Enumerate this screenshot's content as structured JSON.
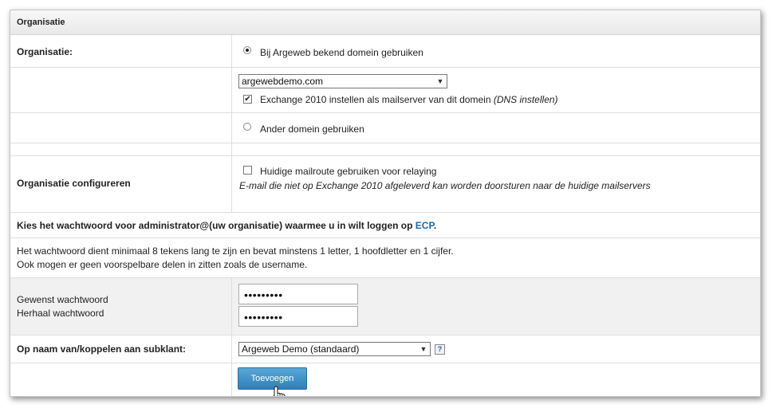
{
  "section_title": "Organisatie",
  "organisatie": {
    "label": "Organisatie:",
    "option_known": "Bij Argeweb bekend domein gebruiken",
    "domain_select": "argewebdemo.com",
    "exchange_check_label": "Exchange 2010 instellen als mailserver van dit domein",
    "exchange_check_note": "(DNS instellen)",
    "option_other": "Ander domein gebruiken"
  },
  "configureren": {
    "label": "Organisatie configureren",
    "relay_label": "Huidige mailroute gebruiken voor relaying",
    "relay_note": "E-mail die niet op Exchange 2010 afgeleverd kan worden doorsturen naar de huidige mailservers"
  },
  "password": {
    "heading_prefix": "Kies het wachtwoord voor administrator@(uw organisatie) waarmee u in wilt loggen op",
    "heading_link": "ECP",
    "heading_suffix": ".",
    "rule_line1": "Het wachtwoord dient minimaal 8 tekens lang te zijn en bevat minstens 1 letter, 1 hoofdletter en 1 cijfer.",
    "rule_line2": "Ook mogen er geen voorspelbare delen in zitten zoals de username.",
    "label_desired": "Gewenst wachtwoord",
    "label_repeat": "Herhaal wachtwoord",
    "value_desired": "•••••••••",
    "value_repeat": "•••••••••"
  },
  "subklant": {
    "label": "Op naam van/koppelen aan subklant:",
    "select_value": "Argeweb Demo (standaard)",
    "help_glyph": "?"
  },
  "submit_label": "Toevoegen",
  "colors": {
    "button": "#3a8cc6",
    "link": "#1b66b3"
  },
  "icons": [
    "radio-selected-icon",
    "radio-icon",
    "checkbox-checked-icon",
    "checkbox-icon",
    "chevron-down-icon",
    "help-icon",
    "hand-cursor-icon"
  ]
}
